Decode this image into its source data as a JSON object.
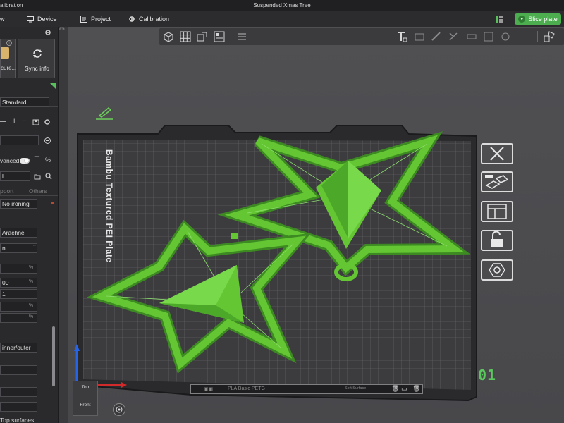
{
  "window": {
    "title": "Suspended Xmas Tree",
    "left_fragment": "alibration"
  },
  "menubar": {
    "items": [
      {
        "label": "w",
        "icon": "none"
      },
      {
        "label": "Device",
        "icon": "device-icon"
      },
      {
        "label": "Project",
        "icon": "project-icon"
      },
      {
        "label": "Calibration",
        "icon": "calibration-icon"
      }
    ],
    "slice_label": "Slice plate",
    "accent": "#4cae4f"
  },
  "left_panel": {
    "filament_label": "cure...",
    "sync_label": "Sync info",
    "plate_type": "Standard",
    "advanced_label": "vanced",
    "search_value": "l",
    "tabs": [
      "pport",
      "Others"
    ],
    "ironing_value": "No ironing",
    "wall_generator": "Arachne",
    "values": [
      "n",
      "%",
      "00",
      "1",
      "%",
      "%"
    ],
    "wall_sequence": "inner/outer",
    "bottom_label": "Top surfaces"
  },
  "viewport": {
    "plate_name": "Bambu Textured PEI Plate",
    "plate_number": "01",
    "bottom_strip": {
      "left": "PLA Basic PETG",
      "right": "Soft Surface"
    },
    "viewcube": {
      "top": "Top",
      "front": "Front"
    },
    "model_color": "#63c632"
  }
}
